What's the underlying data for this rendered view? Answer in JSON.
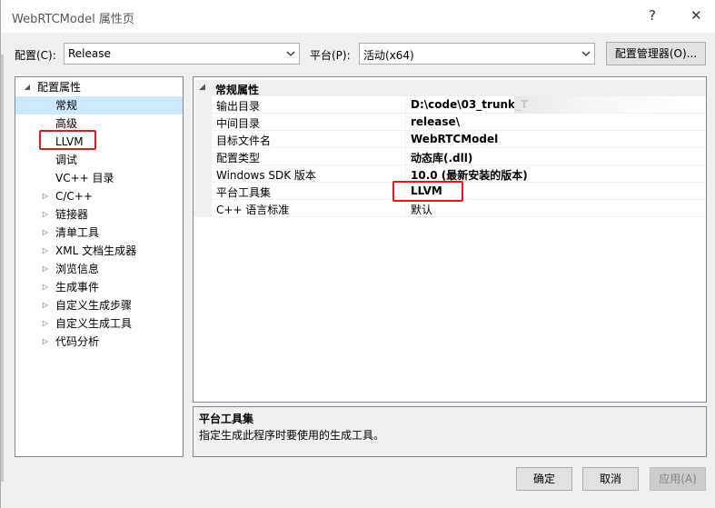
{
  "window": {
    "title": "WebRTCModel 属性页"
  },
  "titlebar": {
    "help_label": "?",
    "close_label": "✕"
  },
  "toolbar": {
    "config_label": "配置(C):",
    "config_value": "Release",
    "platform_label": "平台(P):",
    "platform_value": "活动(x64)",
    "config_manager_label": "配置管理器(O)..."
  },
  "tree": {
    "root": "配置属性",
    "items": [
      {
        "label": "常规",
        "expandable": false,
        "selected": true
      },
      {
        "label": "高级",
        "expandable": false
      },
      {
        "label": "LLVM",
        "expandable": false
      },
      {
        "label": "调试",
        "expandable": false
      },
      {
        "label": "VC++ 目录",
        "expandable": false
      },
      {
        "label": "C/C++",
        "expandable": true
      },
      {
        "label": "链接器",
        "expandable": true
      },
      {
        "label": "清单工具",
        "expandable": true
      },
      {
        "label": "XML 文档生成器",
        "expandable": true
      },
      {
        "label": "浏览信息",
        "expandable": true
      },
      {
        "label": "生成事件",
        "expandable": true
      },
      {
        "label": "自定义生成步骤",
        "expandable": true
      },
      {
        "label": "自定义生成工具",
        "expandable": true
      },
      {
        "label": "代码分析",
        "expandable": true
      }
    ]
  },
  "grid": {
    "category": "常规属性",
    "rows": [
      {
        "name": "输出目录",
        "value": "D:\\code\\03_trunk_T"
      },
      {
        "name": "中间目录",
        "value": "release\\"
      },
      {
        "name": "目标文件名",
        "value": "WebRTCModel"
      },
      {
        "name": "配置类型",
        "value": "动态库(.dll)"
      },
      {
        "name": "Windows SDK 版本",
        "value": "10.0 (最新安装的版本)"
      },
      {
        "name": "平台工具集",
        "value": "LLVM"
      },
      {
        "name": "C++ 语言标准",
        "value": "默认"
      }
    ]
  },
  "description": {
    "title": "平台工具集",
    "text": "指定生成此程序时要使用的生成工具。"
  },
  "buttons": {
    "ok": "确定",
    "cancel": "取消",
    "apply": "应用(A)"
  },
  "colors": {
    "highlight": "#e3191b",
    "selection": "#cde8ff"
  }
}
